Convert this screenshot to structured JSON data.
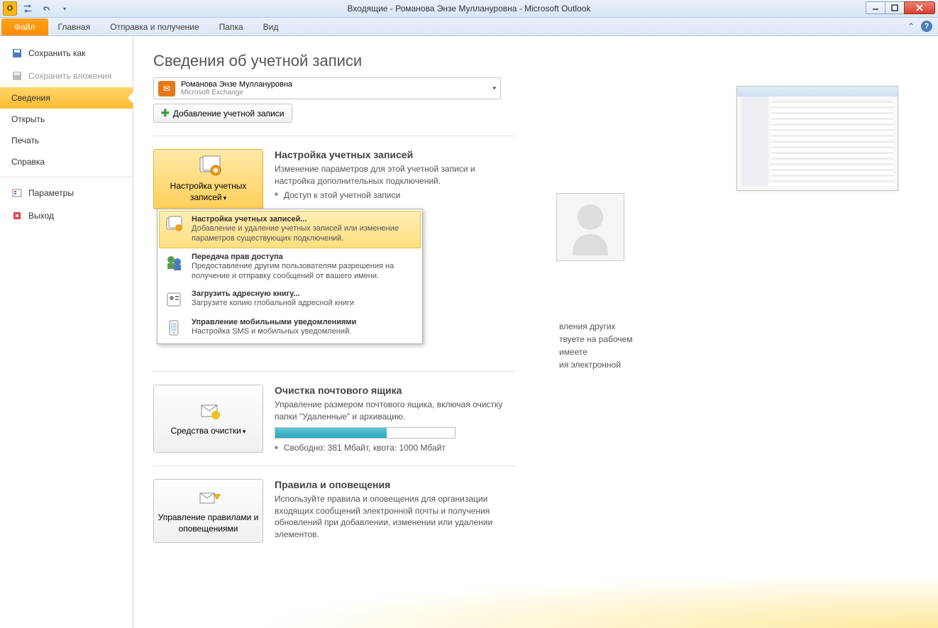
{
  "titlebar": {
    "title": "Входящие - Романова Энзе Муллануровна - Microsoft Outlook"
  },
  "ribbon": {
    "file": "Файл",
    "tabs": [
      "Главная",
      "Отправка и получение",
      "Папка",
      "Вид"
    ]
  },
  "sidebar": {
    "save_as": "Сохранить как",
    "save_attachments": "Сохранить вложения",
    "info": "Сведения",
    "open": "Открыть",
    "print": "Печать",
    "help": "Справка",
    "options": "Параметры",
    "exit": "Выход"
  },
  "content": {
    "heading": "Сведения об учетной записи",
    "account_name": "Романова Энзе Муллануровна",
    "account_type": "Microsoft Exchange",
    "add_account": "Добавление учетной записи",
    "sections": {
      "accounts": {
        "button": "Настройка учетных записей",
        "title": "Настройка учетных записей",
        "desc": "Изменение параметров для этой учетной записи и настройка дополнительных подключений.",
        "bullet": "Доступ к этой учетной записи"
      },
      "cleanup": {
        "button": "Средства очистки",
        "title": "Очистка почтового ящика",
        "desc": "Управление размером почтового ящика, включая очистку папки \"Удаленные\" и архивацию.",
        "quota": "Свободно: 381 Мбайт, квота: 1000 Мбайт",
        "progress_percent": 62
      },
      "rules": {
        "button": "Управление правилами и оповещениями",
        "title": "Правила и оповещения",
        "desc": "Используйте правила и оповещения для организации входящих сообщений электронной почты и получения обновлений при добавлении, изменении или удалении элементов."
      }
    },
    "partial": {
      "l1": "вления других",
      "l2": "твуете на рабочем",
      "l3": "имеете",
      "l4": "ия электронной"
    }
  },
  "dropdown": {
    "items": [
      {
        "title": "Настройка учетных записей...",
        "desc": "Добавление и удаление учетных записей или изменение параметров существующих подключений."
      },
      {
        "title": "Передача прав доступа",
        "desc": "Предоставление другим пользователям разрешения на получение и отправку сообщений от вашего имени."
      },
      {
        "title": "Загрузить адресную книгу...",
        "desc": "Загрузите копию глобальной адресной книги"
      },
      {
        "title": "Управление мобильными уведомлениями",
        "desc": "Настройка SMS и мобильных уведомлений."
      }
    ]
  }
}
